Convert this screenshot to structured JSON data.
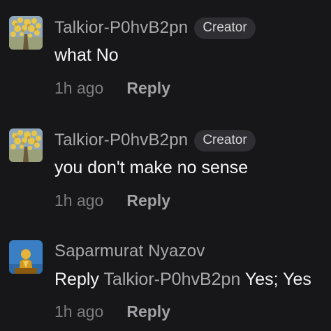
{
  "comments": [
    {
      "avatar_icon": "tree-flowers-avatar",
      "username": "Talkior-P0hvB2pn",
      "badge": "Creator",
      "text": "what No",
      "time": "1h ago",
      "reply_label": "Reply"
    },
    {
      "avatar_icon": "tree-flowers-avatar",
      "username": "Talkior-P0hvB2pn",
      "badge": "Creator",
      "text": "you don't make no sense",
      "time": "1h ago",
      "reply_label": "Reply"
    },
    {
      "avatar_icon": "golden-statue-avatar",
      "username": "Saparmurat Nyazov",
      "reply_prefix": "Reply",
      "reply_to": "Talkior-P0hvB2pn",
      "text": "Yes; Yes",
      "time": "1h ago",
      "reply_label": "Reply"
    }
  ],
  "colors": {
    "background": "#17171a",
    "username": "#a9a9ad",
    "badge_bg": "#2f2f33",
    "text": "#f4f4f6",
    "time": "#7d7d82"
  }
}
